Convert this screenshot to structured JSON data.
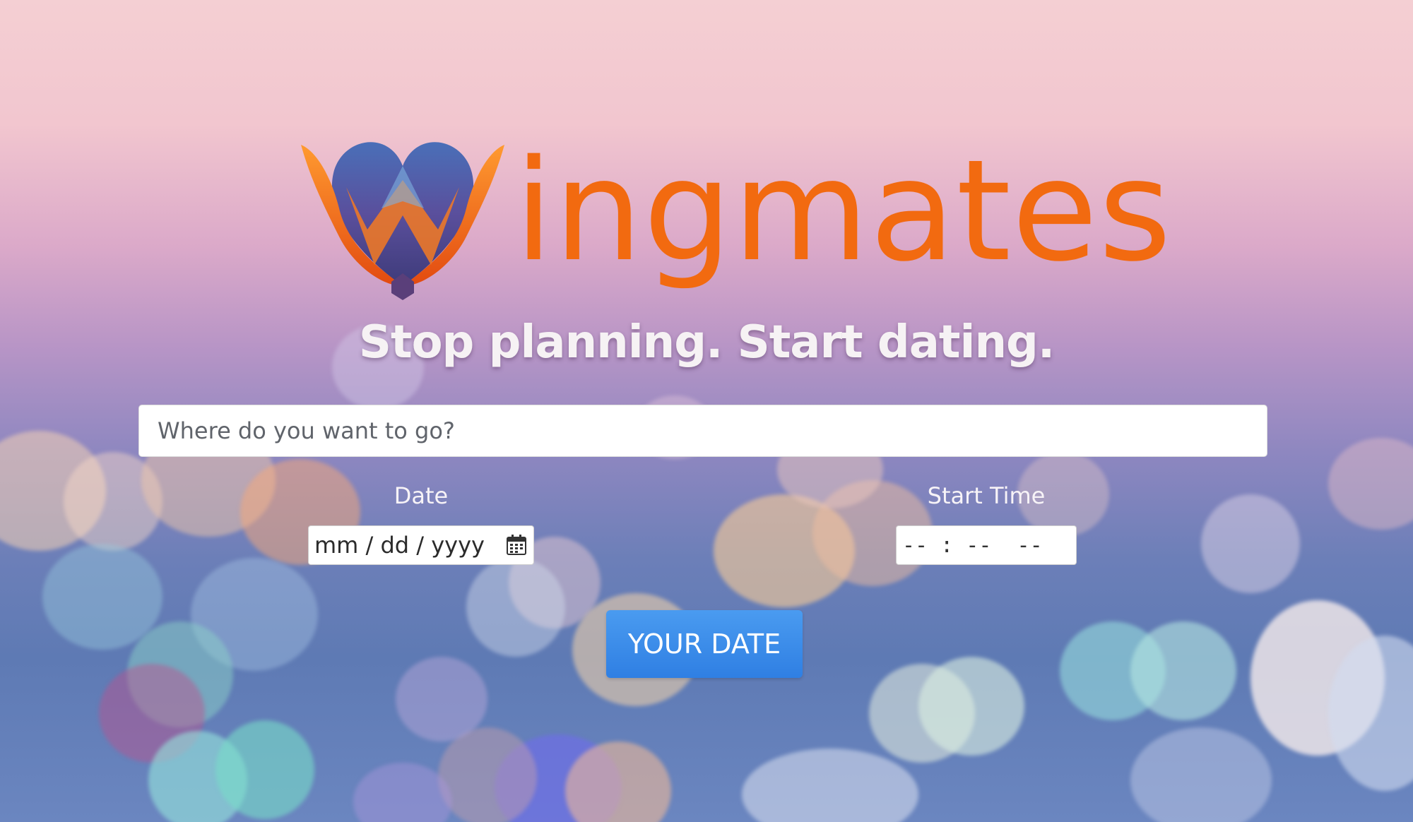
{
  "brand": {
    "name": "ingmates",
    "logo_icon": "winged-heart-logo-icon",
    "color": "#f26a10"
  },
  "hero": {
    "tagline": "Stop planning. Start dating."
  },
  "search": {
    "placeholder": "Where do you want to go?",
    "value": ""
  },
  "date_field": {
    "label": "Date",
    "placeholder": "mm / dd / yyyy",
    "icon": "calendar-icon"
  },
  "time_field": {
    "label": "Start Time",
    "placeholder": "-- : --  --"
  },
  "submit": {
    "label": "YOUR DATE",
    "color": "#3a8be8"
  }
}
